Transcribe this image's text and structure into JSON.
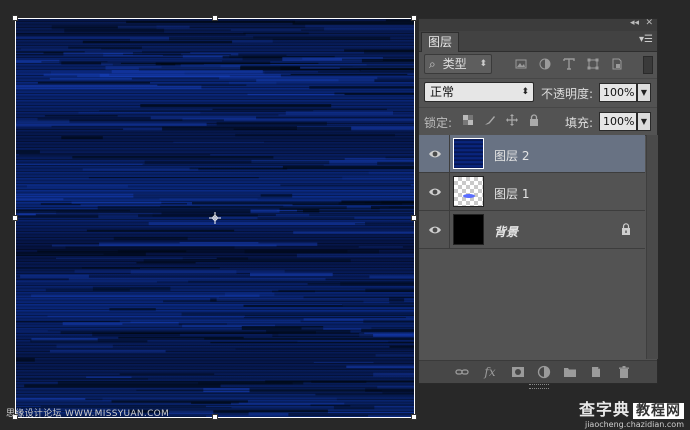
{
  "panel": {
    "collapse_glyph": "◂◂",
    "close_glyph": "✕",
    "tab_label": "图层",
    "menu_glyph": "▾☰"
  },
  "filter": {
    "search_glyph": "⌕",
    "kind_label": "类型",
    "icons": [
      "image-filter-icon",
      "adjustment-filter-icon",
      "type-filter-icon",
      "shape-filter-icon",
      "smart-object-filter-icon"
    ]
  },
  "blend": {
    "mode": "正常",
    "opacity_label": "不透明度:",
    "opacity_value": "100%",
    "fill_label": "填充:",
    "fill_value": "100%"
  },
  "lock": {
    "label": "锁定:",
    "icons": [
      "lock-transparent-icon",
      "lock-image-icon",
      "lock-position-icon",
      "lock-all-icon"
    ]
  },
  "layers": [
    {
      "name": "图层 2",
      "selected": true,
      "thumb": "blue-texture"
    },
    {
      "name": "图层 1",
      "selected": false,
      "thumb": "transparent-with-blue-blob"
    },
    {
      "name": "背景",
      "selected": false,
      "thumb": "black",
      "locked": true
    }
  ],
  "bottom_bar": {
    "icons": [
      "link-layers-icon",
      "fx-icon",
      "add-mask-icon",
      "adjustment-layer-icon",
      "group-folder-icon",
      "new-layer-icon",
      "trash-icon"
    ],
    "fx_text": "fx"
  },
  "watermarks": {
    "left": "思缘设计论坛 WWW.MISSYUAN.COM",
    "right_main": "查字典",
    "right_box": "教程网",
    "right_sub": "jiaocheng.chazidian.com"
  },
  "colors": {
    "panel_bg": "#535353",
    "selected_row": "#687283",
    "canvas_blue": "#0a2a86"
  }
}
